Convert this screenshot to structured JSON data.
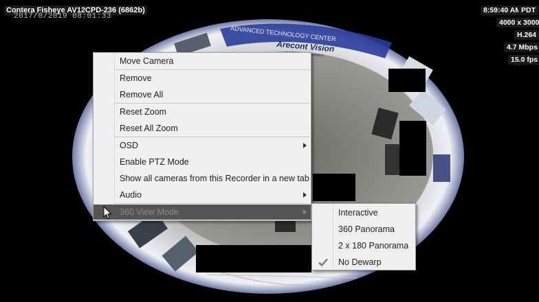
{
  "camera": {
    "title": "Contera Fisheye AV12CPD-236  (6862b)",
    "timestamp": "2017/0/2019 08:01:33",
    "time": "8:59:40 AM",
    "timezone": "PDT",
    "resolution": "4000 x 3000",
    "codec": "H.264",
    "bitrate": "4.7 Mbps",
    "framerate": "15.0 fps"
  },
  "scene": {
    "sign_line1": "ADVANCED TECHNOLOGY CENTER",
    "sign_brand": "Arecont Vision",
    "sign_tagline": "A COSTAR COMPANY"
  },
  "context_menu": {
    "items": [
      {
        "label": "Move Camera"
      },
      {
        "label": "Remove"
      },
      {
        "label": "Remove All"
      },
      {
        "label": "Reset Zoom"
      },
      {
        "label": "Reset All Zoom"
      },
      {
        "label": "OSD"
      },
      {
        "label": "Enable PTZ Mode"
      },
      {
        "label": "Show all cameras from this Recorder in a new tab"
      },
      {
        "label": "Audio"
      },
      {
        "label": "360 View Mode"
      }
    ]
  },
  "submenu": {
    "items": [
      {
        "label": "Interactive"
      },
      {
        "label": "360 Panorama"
      },
      {
        "label": "2 x 180 Panorama"
      },
      {
        "label": "No Dewarp"
      }
    ],
    "checked": "No Dewarp"
  },
  "colors": {
    "menu_bg": "#f0f0f0",
    "highlight_bg": "#555555",
    "osd_bg": "#1a1a1a"
  }
}
